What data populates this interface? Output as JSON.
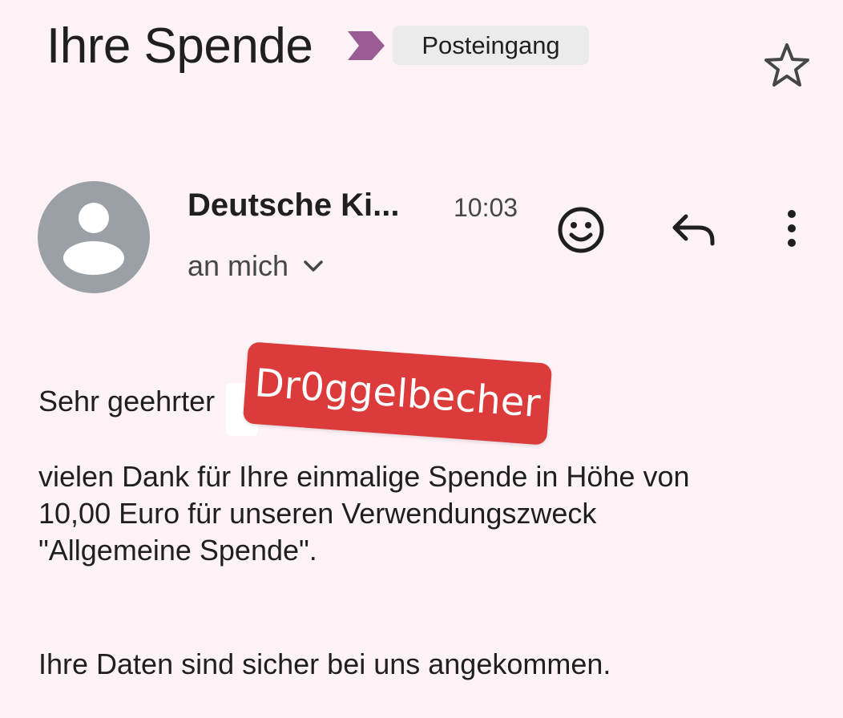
{
  "header": {
    "subject": "Ihre Spende",
    "label": "Posteingang",
    "icons": {
      "importance": "importance-marker-icon",
      "star": "star-icon"
    },
    "colors": {
      "importance": "#9b5c96",
      "chip_background": "#ebebeb"
    }
  },
  "message": {
    "sender": "Deutsche Ki...",
    "time": "10:03",
    "recipient": "an mich",
    "icons": {
      "avatar": "person-avatar-icon",
      "recipient_expand": "chevron-down-icon",
      "emoji": "emoji-reaction-icon",
      "reply": "reply-icon",
      "more": "more-vert-icon"
    }
  },
  "body": {
    "greeting": "Sehr geehrter",
    "redaction_sticker": "Dr0ggelbecher",
    "paragraph_1": [
      "vielen Dank für Ihre einmalige Spende in Höhe von",
      "10,00 Euro für unseren Verwendungszweck",
      "\"Allgemeine Spende\"."
    ],
    "paragraph_2": "Ihre Daten sind sicher bei uns angekommen.",
    "colors": {
      "sticker": "#dc3b3b",
      "background": "#fdf3f7"
    }
  }
}
